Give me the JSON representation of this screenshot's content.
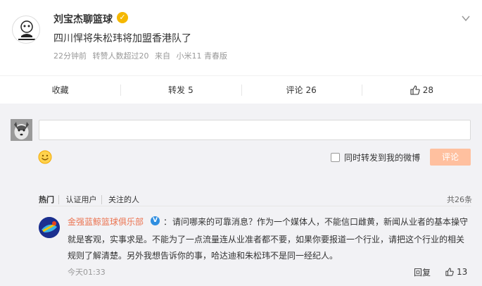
{
  "post": {
    "username": "刘宝杰聊篮球",
    "verified_icon": "verified-badge-gold",
    "text": "四川悍将朱松玮将加盟香港队了",
    "meta": [
      "22分钟前",
      "转赞人数超过20",
      "来自",
      "小米11 青春版"
    ]
  },
  "actions": [
    {
      "label": "收藏",
      "count": ""
    },
    {
      "label": "转发",
      "count": "5"
    },
    {
      "label": "评论",
      "count": "26"
    },
    {
      "label": "",
      "count": "28",
      "icon": "thumbs-up-icon"
    }
  ],
  "reply": {
    "repost_label": "同时转发到我的微博",
    "submit_label": "评论",
    "submit_color": "#ffc09f"
  },
  "comments": {
    "filters": [
      "热门",
      "认证用户",
      "关注的人"
    ],
    "total": "共26条",
    "items": [
      {
        "author": "金强蓝鲸篮球俱乐部",
        "colon": "：",
        "lines": [
          "请问哪来的可靠消息？作为一个媒体人，不能信口雌黄，新闻从业者的基本操守",
          "就是客观，实事求是。不能为了一点流量连从业准者都不要，如果你要报道一个行业，请把这个行业的相关",
          "规则了解清楚。另外我想告诉你的事，哈达迪和朱松玮不是同一经纪人。"
        ],
        "time": "今天01:33",
        "reply_label": "回复",
        "likes": "13"
      }
    ]
  },
  "colors": {
    "accent": "#eb7350",
    "verified": "#f5b800"
  }
}
